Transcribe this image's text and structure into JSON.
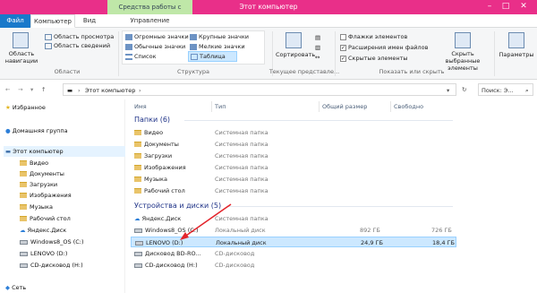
{
  "window": {
    "title": "Этот компьютер",
    "contextual_tab": "Средства работы с дисками"
  },
  "tabs": [
    {
      "label": "Файл"
    },
    {
      "label": "Компьютер"
    },
    {
      "label": "Вид"
    },
    {
      "label": "Управление"
    }
  ],
  "ribbon": {
    "areas": {
      "label": "Области",
      "nav_pane": "Область навигации",
      "preview": "Область просмотра",
      "details": "Область сведений"
    },
    "layout": {
      "label": "Структура",
      "large": "Огромные значки",
      "big": "Крупные значки",
      "normal": "Обычные значки",
      "small": "Мелкие значки",
      "list": "Список",
      "table": "Таблица"
    },
    "current_view": {
      "label": "Текущее представле...",
      "sort": "Сортировать"
    },
    "show_hide": {
      "label": "Показать или скрыть",
      "checkboxes": "Флажки элементов",
      "extensions": "Расширения имен файлов",
      "hidden": "Скрытые элементы",
      "hide_selected": "Скрыть выбранные элементы"
    },
    "params": "Параметры"
  },
  "address": {
    "path": "Этот компьютер",
    "search_placeholder": "Поиск: Э..."
  },
  "nav": {
    "favorites": "Избранное",
    "homegroup": "Домашняя группа",
    "thispc": "Этот компьютер",
    "items": [
      "Видео",
      "Документы",
      "Загрузки",
      "Изображения",
      "Музыка",
      "Рабочий стол",
      "Яндекс.Диск",
      "Windows8_OS (C:)",
      "LENOVO (D:)",
      "CD-дисковод (H:)"
    ],
    "network": "Сеть"
  },
  "columns": {
    "name": "Имя",
    "type": "Тип",
    "total": "Общий размер",
    "free": "Свободно"
  },
  "folders": {
    "header": "Папки (6)",
    "rows": [
      {
        "name": "Видео",
        "type": "Системная папка"
      },
      {
        "name": "Документы",
        "type": "Системная папка"
      },
      {
        "name": "Загрузки",
        "type": "Системная папка"
      },
      {
        "name": "Изображения",
        "type": "Системная папка"
      },
      {
        "name": "Музыка",
        "type": "Системная папка"
      },
      {
        "name": "Рабочий стол",
        "type": "Системная папка"
      }
    ]
  },
  "devices": {
    "header": "Устройства и диски (5)",
    "rows": [
      {
        "name": "Яндекс.Диск",
        "type": "Системная папка",
        "total": "",
        "free": ""
      },
      {
        "name": "Windows8_OS (C:)",
        "type": "Локальный диск",
        "total": "892 ГБ",
        "free": "726 ГБ"
      },
      {
        "name": "LENOVO (D:)",
        "type": "Локальный диск",
        "total": "24,9 ГБ",
        "free": "18,4 ГБ"
      },
      {
        "name": "Дисковод BD-RO...",
        "type": "CD-дисковод",
        "total": "",
        "free": ""
      },
      {
        "name": "CD-дисковод (H:)",
        "type": "CD-дисковод",
        "total": "",
        "free": ""
      }
    ]
  },
  "colors": {
    "title_bar": "#e92f89",
    "file_tab": "#1979ca",
    "context_tab": "#bfe7a8",
    "selection": "#cce8ff",
    "section": "#1e3287",
    "arrow": "#e3242b"
  }
}
